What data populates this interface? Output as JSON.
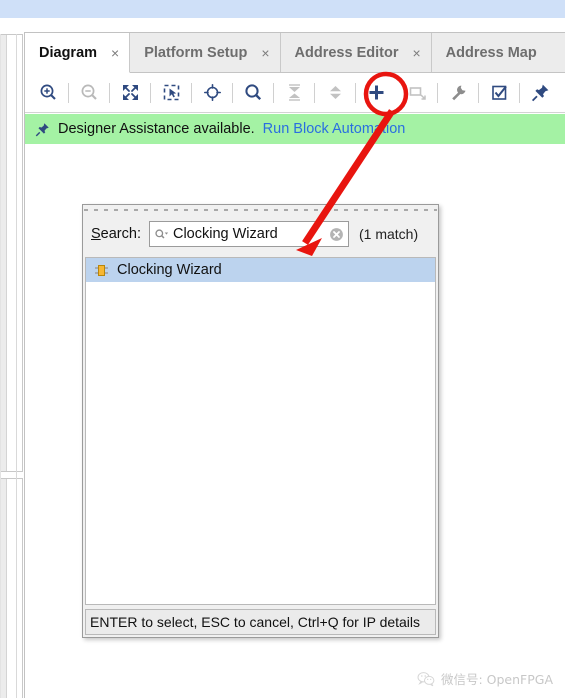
{
  "window": {
    "top_strip_color": "#cfe0f8"
  },
  "tabs": [
    {
      "label": "Diagram",
      "close": "×",
      "active": true
    },
    {
      "label": "Platform Setup",
      "close": "×",
      "active": false
    },
    {
      "label": "Address Editor",
      "close": "×",
      "active": false
    },
    {
      "label": "Address Map",
      "close": "",
      "active": false
    }
  ],
  "toolbar": {
    "items": [
      {
        "name": "zoom-in-icon",
        "enabled": true
      },
      {
        "name": "zoom-out-icon",
        "enabled": false
      },
      {
        "name": "fit-to-window-icon",
        "enabled": true
      },
      {
        "name": "zoom-to-selection-icon",
        "enabled": true
      },
      {
        "name": "locate-target-icon",
        "enabled": true
      },
      {
        "name": "search-icon",
        "enabled": true
      },
      {
        "name": "collapse-all-icon",
        "enabled": false
      },
      {
        "name": "expand-all-icon",
        "enabled": false
      },
      {
        "name": "add-ip-icon",
        "enabled": true
      },
      {
        "name": "add-module-icon",
        "enabled": false
      },
      {
        "name": "run-connection-automation-icon",
        "enabled": true
      },
      {
        "name": "validate-design-icon",
        "enabled": true
      },
      {
        "name": "pin-icon",
        "enabled": true
      }
    ]
  },
  "assistance": {
    "icon": "pin-icon",
    "text": "Designer Assistance available.",
    "link": "Run Block Automation",
    "background_color": "#a4f2a4",
    "link_color": "#2a6ee0"
  },
  "ip_popup": {
    "search_label_prefix": "S",
    "search_label_rest": "earch:",
    "search_value": "Clocking Wizard",
    "search_placeholder": "Search",
    "search_icon": "search-dropdown-icon",
    "clear_icon": "clear-icon",
    "match_count": "(1 match)",
    "results": [
      {
        "label": "Clocking Wizard",
        "icon": "ip-core-icon",
        "selected": true
      }
    ],
    "status_text": "ENTER to select, ESC to cancel, Ctrl+Q for IP details",
    "selection_color": "#bcd3ee"
  },
  "annotation": {
    "highlight_color": "#e8150f",
    "circle_target": "add-ip-icon",
    "arrow_target": "search-field"
  },
  "watermark": {
    "icon": "wechat-icon",
    "text": "微信号: OpenFPGA"
  }
}
